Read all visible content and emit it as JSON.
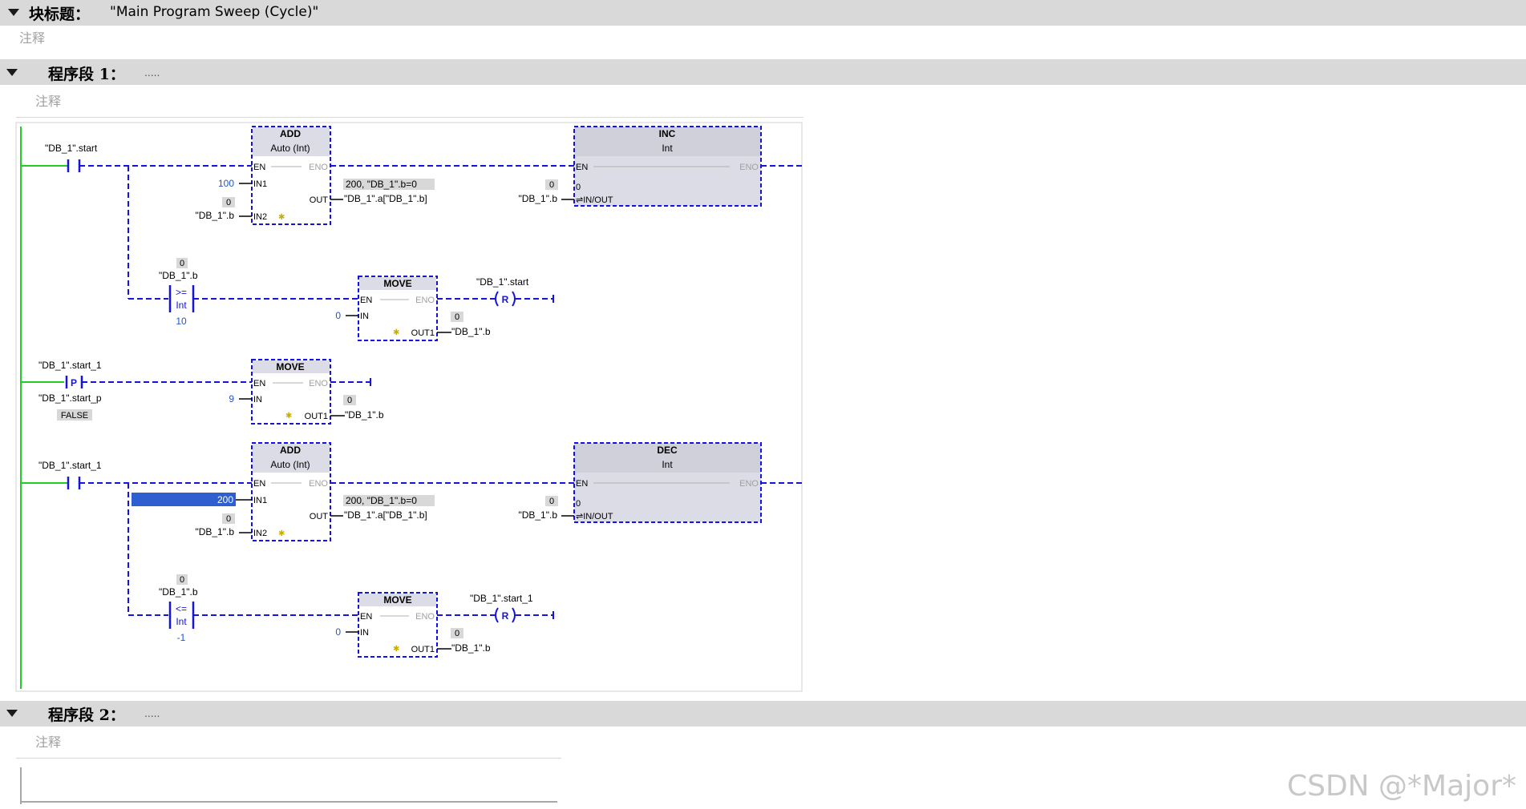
{
  "block": {
    "title_label": "块标题：",
    "name": "\"Main Program Sweep (Cycle)\"",
    "comment": "注释"
  },
  "segment1": {
    "title": "程序段 1：",
    "dots": ".....",
    "comment": "注释"
  },
  "segment2": {
    "title": "程序段 2：",
    "dots": ".....",
    "comment": "注释"
  },
  "ladder": {
    "r1_contact_tag": "\"DB_1\".start",
    "add1": {
      "name": "ADD",
      "type": "Auto (Int)",
      "en": "EN",
      "eno": "ENO",
      "in1": "IN1",
      "in2": "IN2",
      "out": "OUT",
      "in1_val": "100",
      "in2_val": "0",
      "in2_tag": "\"DB_1\".b",
      "out_val": "200, \"DB_1\".b=0",
      "out_tag": "\"DB_1\".a[\"DB_1\".b]"
    },
    "inc": {
      "name": "INC",
      "type": "Int",
      "en": "EN",
      "eno": "ENO",
      "inout": "⇌IN/OUT",
      "val": "0",
      "tag": "\"DB_1\".b",
      "inner": "0"
    },
    "cmp1": {
      "val": "0",
      "tag": "\"DB_1\".b",
      "op": ">=",
      "type": "Int",
      "ref": "10"
    },
    "move1": {
      "name": "MOVE",
      "en": "EN",
      "eno": "ENO",
      "in": "IN",
      "out": "OUT1",
      "in_val": "0",
      "out_val": "0",
      "out_tag": "\"DB_1\".b"
    },
    "reset1": {
      "tag": "\"DB_1\".start",
      "coil": "R"
    },
    "r2_contact_tag": "\"DB_1\".start_1",
    "r2_p_label": "P",
    "r2_p_tag": "\"DB_1\".start_p",
    "r2_p_state": "FALSE",
    "move2": {
      "name": "MOVE",
      "en": "EN",
      "eno": "ENO",
      "in": "IN",
      "out": "OUT1",
      "in_val": "9",
      "out_val": "0",
      "out_tag": "\"DB_1\".b"
    },
    "r3_contact_tag": "\"DB_1\".start_1",
    "add2": {
      "name": "ADD",
      "type": "Auto (Int)",
      "en": "EN",
      "eno": "ENO",
      "in1": "IN1",
      "in2": "IN2",
      "out": "OUT",
      "in1_val": "200",
      "in2_val": "0",
      "in2_tag": "\"DB_1\".b",
      "out_val": "200, \"DB_1\".b=0",
      "out_tag": "\"DB_1\".a[\"DB_1\".b]"
    },
    "dec": {
      "name": "DEC",
      "type": "Int",
      "en": "EN",
      "eno": "ENO",
      "inout": "⇌IN/OUT",
      "val": "0",
      "tag": "\"DB_1\".b",
      "inner": "0"
    },
    "cmp2": {
      "val": "0",
      "tag": "\"DB_1\".b",
      "op": "<=",
      "type": "Int",
      "ref": "-1"
    },
    "move3": {
      "name": "MOVE",
      "en": "EN",
      "eno": "ENO",
      "in": "IN",
      "out": "OUT1",
      "in_val": "0",
      "out_val": "0",
      "out_tag": "\"DB_1\".b"
    },
    "reset2": {
      "tag": "\"DB_1\".start_1",
      "coil": "R"
    }
  },
  "watermark": "CSDN @*Major*",
  "colors": {
    "wire": "#1414dc",
    "rail": "#22cc22",
    "box_fill": "#dcdce6",
    "header": "#d9d9d9",
    "value": "#2255cc",
    "selection": "#2e5fd0"
  }
}
